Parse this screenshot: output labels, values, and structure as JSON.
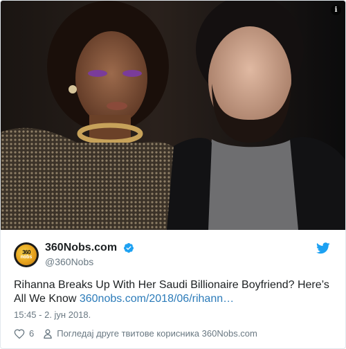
{
  "photo": {
    "info_icon": "i"
  },
  "account": {
    "avatar_text_top": "360",
    "avatar_text_bottom": "nobs",
    "name": "360Nobs.com",
    "handle": "@360Nobs"
  },
  "tweet": {
    "text": "Rihanna Breaks Up With Her Saudi Billionaire Boyfriend? Here’s All We Know ",
    "link": "360nobs.com/2018/06/rihann…",
    "timestamp": "15:45 - 2. јун 2018."
  },
  "actions": {
    "likes": "6",
    "view_more": "Погледај друге твитове корисника 360Nobs.com"
  },
  "colors": {
    "link": "#2b7bb9",
    "twitter_blue": "#1da1f2",
    "secondary_text": "#697882"
  }
}
